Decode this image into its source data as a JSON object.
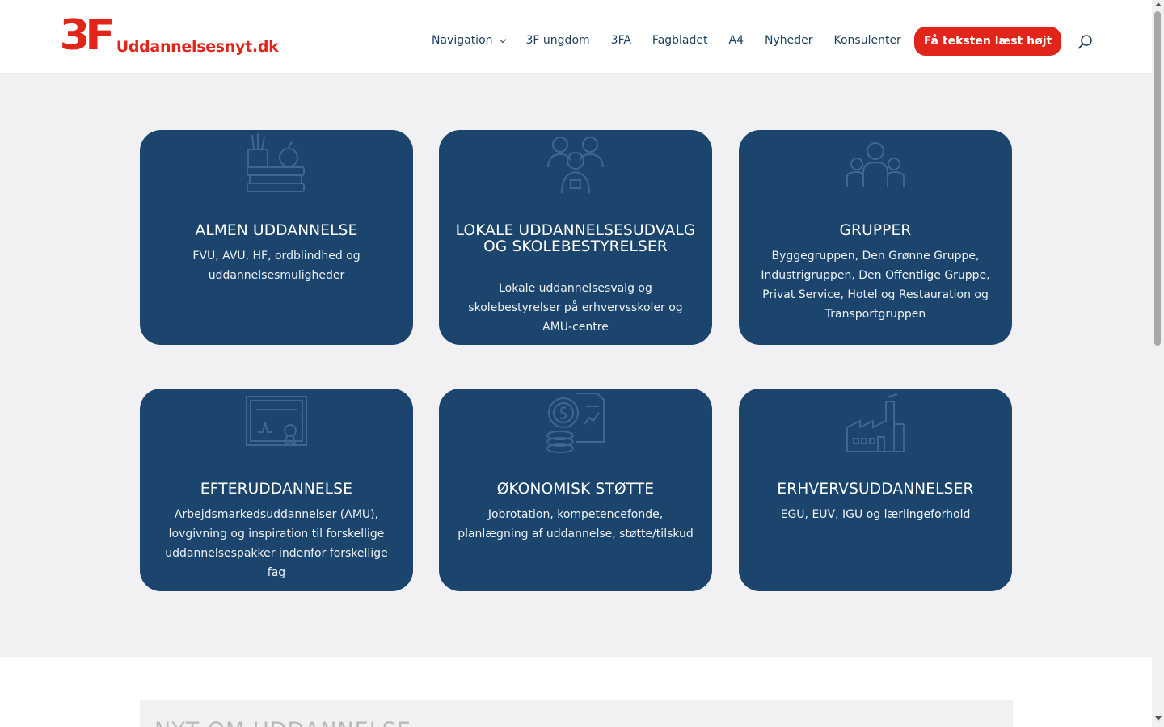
{
  "header": {
    "logo_mark": "3F",
    "logo_text": "Uddannelsesnyt.dk",
    "nav": [
      {
        "label": "Navigation",
        "has_dropdown": true
      },
      {
        "label": "3F ungdom"
      },
      {
        "label": "3FA"
      },
      {
        "label": "Fagbladet"
      },
      {
        "label": "A4"
      },
      {
        "label": "Nyheder"
      },
      {
        "label": "Konsulenter"
      }
    ],
    "cta_label": "Få teksten læst højt",
    "search_icon": "search-icon"
  },
  "colors": {
    "brand_red": "#e1251b",
    "card_blue": "#1b456c",
    "nav_text": "#1b3f5e",
    "band_bg": "#f1f1f3"
  },
  "cards": [
    {
      "icon": "books-apple-icon",
      "title": "ALMEN UDDANNELSE",
      "desc": "FVU, AVU, HF, ordblindhed og uddannelsesmuligheder"
    },
    {
      "icon": "people-group-icon",
      "title": "LOKALE UDDANNELSESUDVALG OG SKOLEBESTYRELSER",
      "desc": "Lokale uddannelsesvalg og skolebestyrelser på erhvervsskoler og AMU-centre"
    },
    {
      "icon": "team-icon",
      "title": "GRUPPER",
      "desc": "Byggegruppen, Den Grønne Gruppe, Industrigruppen, Den Offentlige Gruppe, Privat Service, Hotel og Restauration og Transportgruppen"
    },
    {
      "icon": "certificate-icon",
      "title": "EFTERUDDANNELSE",
      "desc": "Arbejdsmarkedsuddannelser (AMU), lovgivning og inspiration til forskellige uddannelsespakker indenfor forskellige fag"
    },
    {
      "icon": "coins-document-icon",
      "title": "ØKONOMISK STØTTE",
      "desc": "Jobrotation, kompetencefonde, planlægning af uddannelse, støtte/tilskud"
    },
    {
      "icon": "factory-icon",
      "title": "ERHVERVSUDDANNELSER",
      "desc": "EGU, EUV, IGU og lærlingeforhold"
    }
  ],
  "news": {
    "title": "NYT OM UDDANNELSE"
  }
}
